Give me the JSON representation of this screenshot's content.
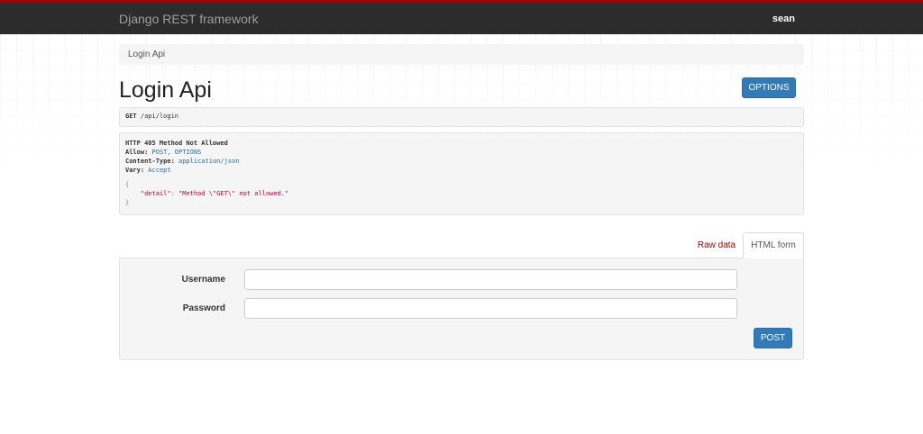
{
  "navbar": {
    "brand": "Django REST framework",
    "user": "sean"
  },
  "breadcrumb": {
    "current": "Login Api"
  },
  "page": {
    "title": "Login Api",
    "options_label": "OPTIONS"
  },
  "request": {
    "method": "GET",
    "path": "/api/login"
  },
  "response": {
    "status_line": "HTTP 405 Method Not Allowed",
    "headers": [
      {
        "name": "Allow:",
        "value": "POST, OPTIONS"
      },
      {
        "name": "Content-Type:",
        "value": "application/json"
      },
      {
        "name": "Vary:",
        "value": "Accept"
      }
    ],
    "body_open": "{",
    "body_key": "\"detail\"",
    "body_sep": ": ",
    "body_value": "\"Method \\\"GET\\\" not allowed.\"",
    "body_close": "}"
  },
  "tabs": {
    "raw_data": "Raw data",
    "html_form": "HTML form"
  },
  "form": {
    "username_label": "Username",
    "password_label": "Password",
    "username_value": "",
    "password_value": "",
    "submit_label": "POST"
  },
  "colors": {
    "accent": "#a30000",
    "navbar_bg": "#2c2c2c",
    "button": "#337ab7"
  }
}
